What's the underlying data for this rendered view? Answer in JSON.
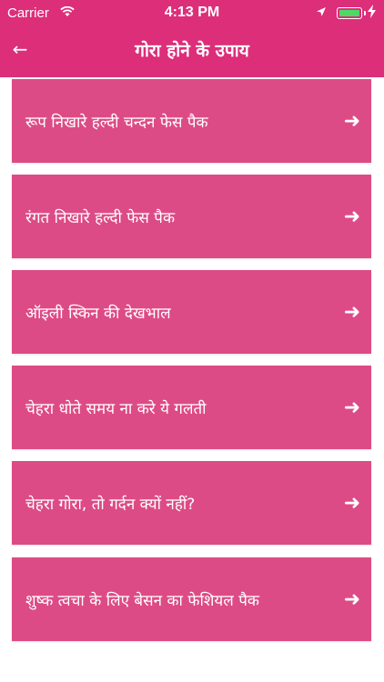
{
  "status_bar": {
    "carrier": "Carrier",
    "time": "4:13 PM",
    "wifi_icon": "wifi-icon",
    "location_icon": "location-arrow-icon",
    "battery_icon": "battery-charging-icon"
  },
  "header": {
    "title": "गोरा होने के उपाय",
    "back_icon": "back-arrow-icon",
    "back_glyph": "←"
  },
  "colors": {
    "header": "#dd2e7a",
    "card": "#dd4b86",
    "text": "#ffffff"
  },
  "items": [
    {
      "label": "रूप निखारे हल्दी चन्दन फेस पैक",
      "arrow": "➜"
    },
    {
      "label": "रंगत निखारे हल्दी फेस पैक",
      "arrow": "➜"
    },
    {
      "label": "ऑइली स्किन की देखभाल",
      "arrow": "➜"
    },
    {
      "label": "चेहरा धोते समय ना करे ये गलती",
      "arrow": "➜"
    },
    {
      "label": "चेहरा गोरा, तो गर्दन क्यों नहीं?",
      "arrow": "➜"
    },
    {
      "label": "शुष्क त्वचा के लिए बेसन का फेशियल पैक",
      "arrow": "➜"
    }
  ]
}
